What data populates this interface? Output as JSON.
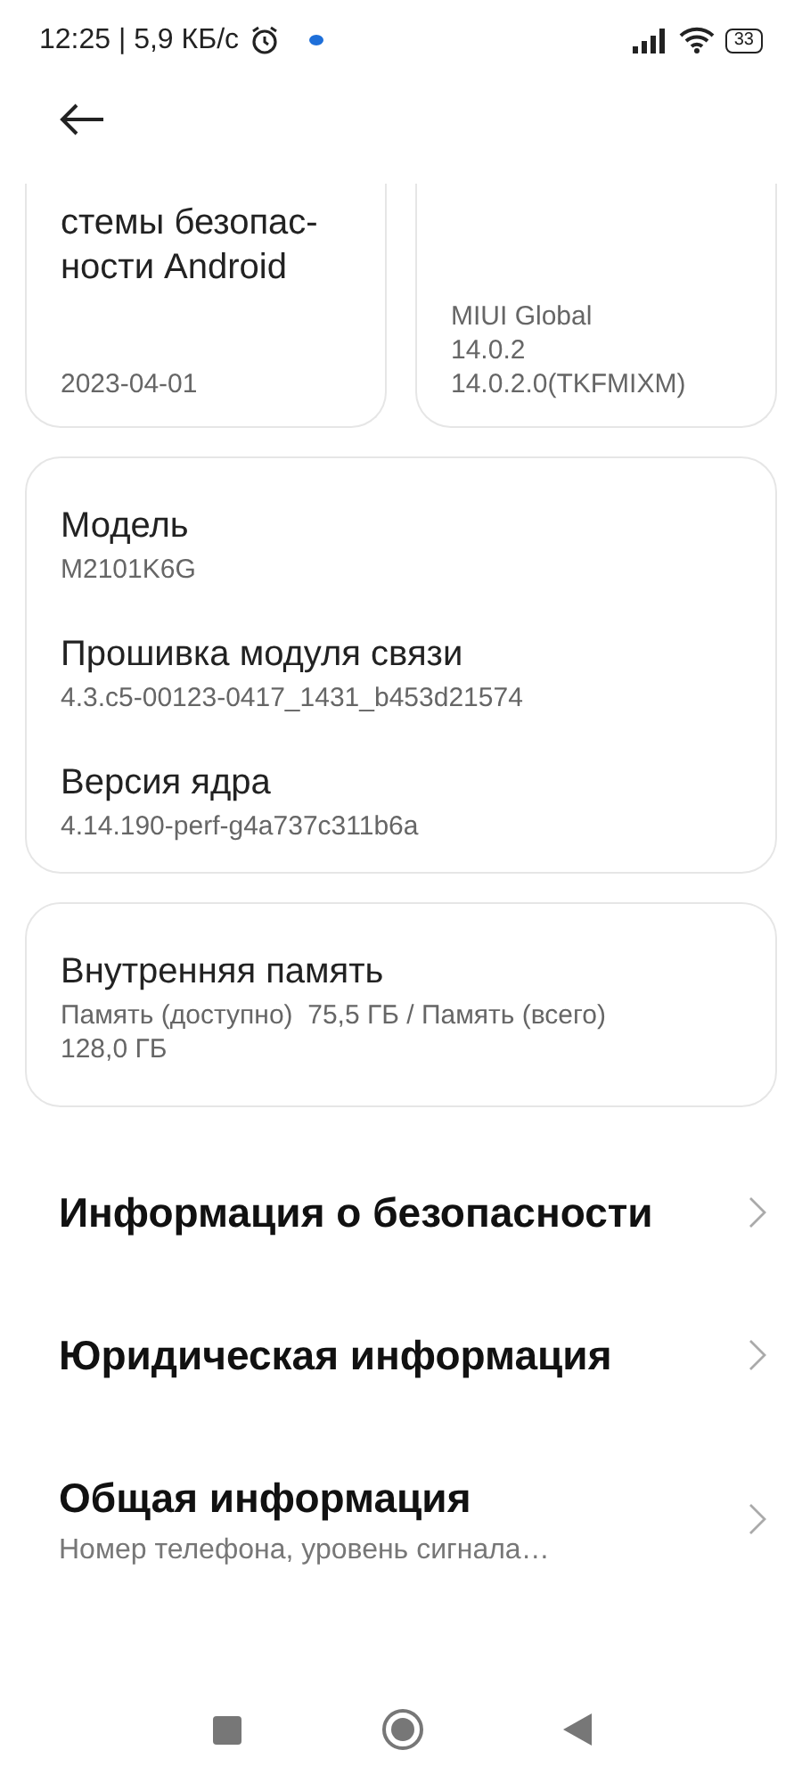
{
  "status_bar": {
    "time_speed": "12:25 | 5,9 КБ/с",
    "battery": "33"
  },
  "top_cards": [
    {
      "title_lines": [
        "стемы безопас-",
        "ности Android"
      ],
      "value_lines": [
        "2023-04-01"
      ]
    },
    {
      "value_lines": [
        "MIUI Global",
        "14.0.2",
        "14.0.2.0(TKFMIXM)"
      ]
    }
  ],
  "device_card": [
    {
      "title": "Модель",
      "value": "M2101K6G"
    },
    {
      "title": "Прошивка модуля связи",
      "value": "4.3.c5-00123-0417_1431_b453d21574"
    },
    {
      "title": "Версия ядра",
      "value": "4.14.190-perf-g4a737c311b6a"
    }
  ],
  "storage_card": {
    "title": "Внутренняя память",
    "value": "Память (доступно)  75,5 ГБ / Память (всего) 128,0 ГБ"
  },
  "menu": [
    {
      "title": "Информация о безопасности"
    },
    {
      "title": "Юридическая информация"
    },
    {
      "title": "Общая информация",
      "subtitle": "Номер телефона, уровень сигнала…"
    }
  ]
}
